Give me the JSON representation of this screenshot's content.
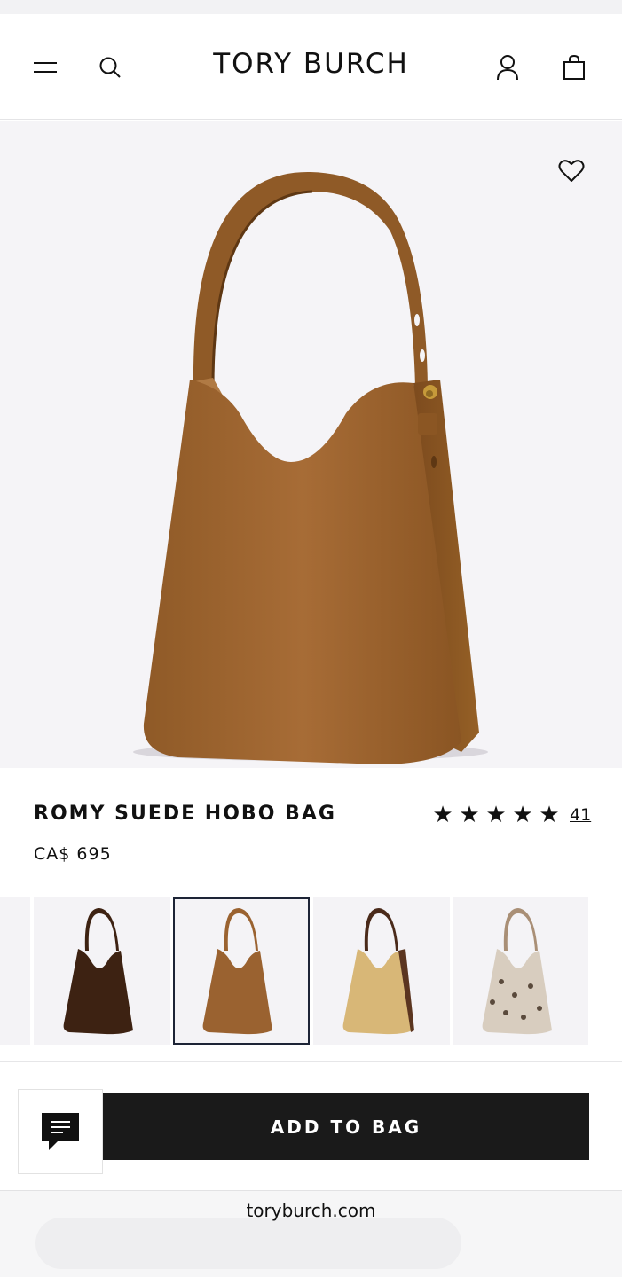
{
  "header": {
    "logo": "TORY BURCH",
    "menu_icon": "hamburger-menu-icon",
    "search_icon": "search-icon",
    "account_icon": "account-icon",
    "bag_icon": "shopping-bag-icon"
  },
  "hero": {
    "image_alt": "Romy Suede Hobo Bag in tan brown suede",
    "wishlist_icon": "heart-icon"
  },
  "product": {
    "title": "ROMY SUEDE HOBO BAG",
    "price": "CA$ 695",
    "rating": 5,
    "review_count": "41"
  },
  "swatches": {
    "selected_index": 1,
    "items": [
      {
        "color": "#3d2212"
      },
      {
        "color": "#9a6230"
      },
      {
        "color": "#d8b777"
      },
      {
        "color": "#cfc2b2"
      }
    ]
  },
  "actions": {
    "add_to_bag": "ADD TO BAG",
    "chat_icon": "chat-icon"
  },
  "browser": {
    "url": "toryburch.com"
  },
  "colors": {
    "button_bg": "#1a1a1a",
    "hero_bg": "#f5f4f7",
    "selected_border": "#1d2436",
    "suede": "#9a6230"
  }
}
